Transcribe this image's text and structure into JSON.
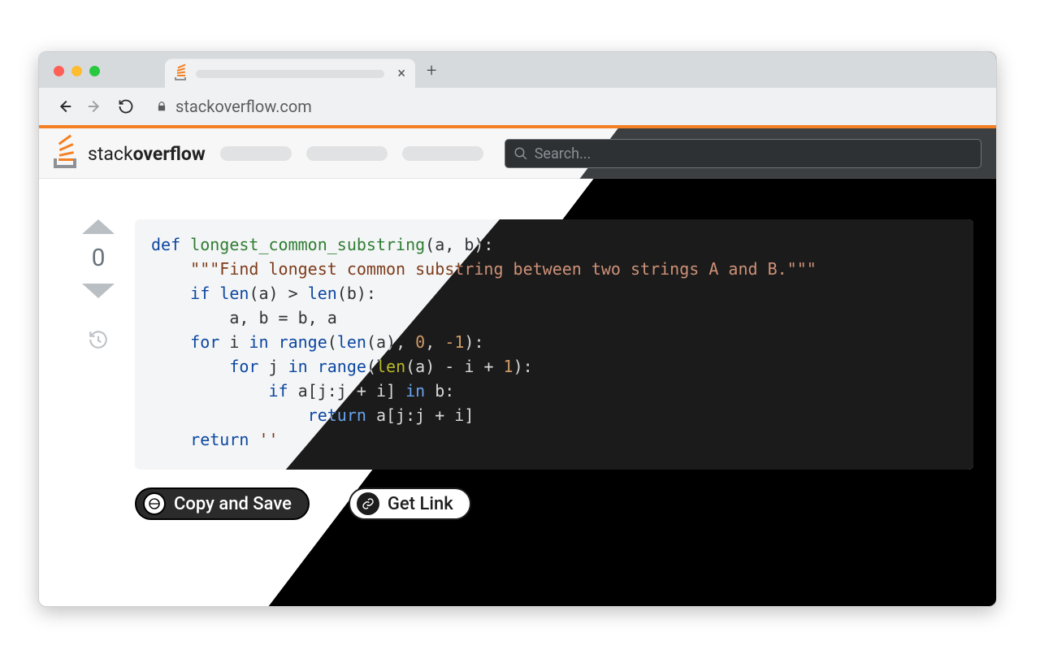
{
  "browser": {
    "url": "stackoverflow.com",
    "new_tab_glyph": "+",
    "close_tab_glyph": "×"
  },
  "site": {
    "logo_prefix": "stack",
    "logo_bold": "overflow",
    "search_placeholder": "Search..."
  },
  "vote": {
    "score": "0"
  },
  "code": {
    "line1_def": "def",
    "line1_fn": "longest_common_substring",
    "line1_rest": "(a, b):",
    "line2_doc": "\"\"\"Find longest common substring between two strings A and B.\"\"\"",
    "line3_if": "if",
    "line3_rest1": " ",
    "line3_len1": "len",
    "line3_rest2": "(a) > ",
    "line3_len2": "len",
    "line3_rest3": "(b):",
    "line4": "a, b = b, a",
    "line5_for": "for",
    "line5_in": "in",
    "line5_range": "range",
    "line5_len": "len",
    "line5_rest": "(a), ",
    "line5_zero": "0",
    "line5_neg1": "-1",
    "line5_close": "):",
    "line6_for": "for",
    "line6_in": "in",
    "line6_range": "range",
    "line6_len": "len",
    "line6_rest": "(a) - i + ",
    "line6_one": "1",
    "line6_close": "):",
    "line7_if": "if",
    "line7_slice": " a[j:j + i] ",
    "line7_in": "in",
    "line7_rest": " b:",
    "line8_return": "return",
    "line8_rest": " a[j:j + i]",
    "line9_return": "return",
    "line9_empty": " ''"
  },
  "buttons": {
    "copy_save": "Copy and Save",
    "get_link": "Get Link"
  }
}
